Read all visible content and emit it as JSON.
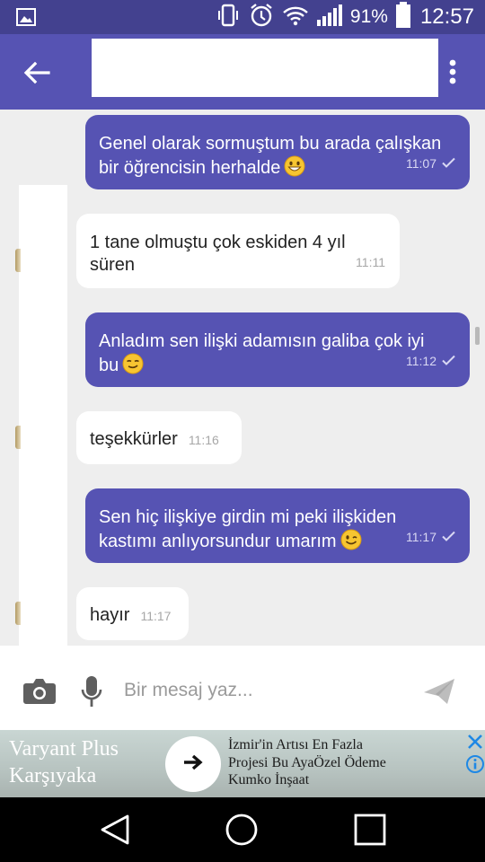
{
  "status_bar": {
    "battery_percent": "91%",
    "time": "12:57",
    "icons": [
      "gallery-icon",
      "vibrate-icon",
      "alarm-icon",
      "wifi-icon",
      "signal-icon",
      "battery-icon"
    ]
  },
  "app_bar": {
    "back_icon": "arrow-back-icon",
    "title": "",
    "menu_icon": "more-vert-icon"
  },
  "messages": [
    {
      "direction": "out",
      "lines": [
        "Genel olarak sormuştum bu arada çalışkan",
        "bir öğrencisin herhalde"
      ],
      "emoji": "grinning-face",
      "time": "11:07",
      "status": "sent-check"
    },
    {
      "direction": "in",
      "lines": [
        "1 tane olmuştu çok eskiden 4 yıl",
        "süren"
      ],
      "time": "11:11"
    },
    {
      "direction": "out",
      "lines": [
        "Anladım sen ilişki adamısın galiba çok iyi",
        "bu"
      ],
      "emoji": "smirking-face",
      "time": "11:12",
      "status": "sent-check"
    },
    {
      "direction": "in",
      "lines": [
        "teşekkürler"
      ],
      "time": "11:16"
    },
    {
      "direction": "out",
      "lines": [
        "Sen hiç ilişkiye girdin mi peki ilişkiden",
        "kastımı anlıyorsundur umarım"
      ],
      "emoji": "winking-face",
      "time": "11:17",
      "status": "sent-check"
    },
    {
      "direction": "in",
      "lines": [
        "hayır"
      ],
      "time": "11:17"
    }
  ],
  "composer": {
    "placeholder": "Bir mesaj yaz...",
    "value": ""
  },
  "ad": {
    "brand_line1": "Varyant Plus",
    "brand_line2": "Karşıyaka",
    "text_line1": "İzmir'in Artısı En Fazla",
    "text_line2": "Projesi Bu AyaÖzel Ödeme",
    "text_line3": "Kumko İnşaat",
    "accent_color": "#1e88e5"
  },
  "colors": {
    "app_bar": "#5653b3",
    "status_bar": "#43418f",
    "outgoing_bubble": "#5653b3",
    "incoming_bubble": "#ffffff",
    "chat_background": "#eeeeee"
  }
}
